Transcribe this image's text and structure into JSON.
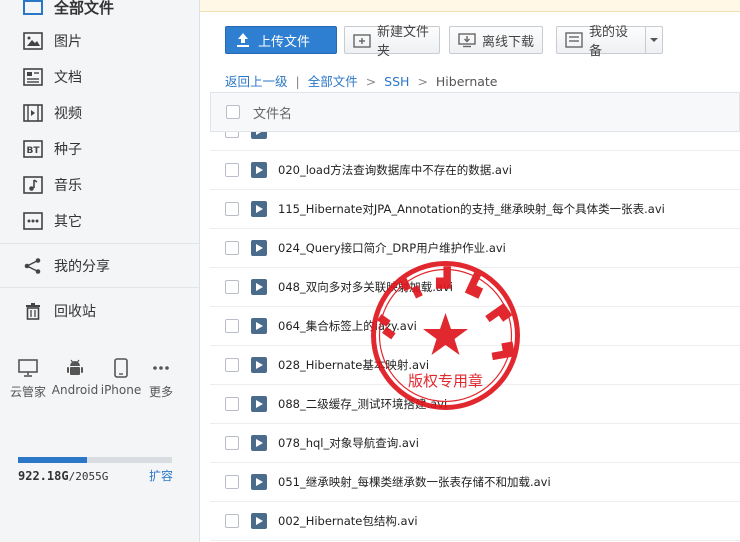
{
  "sidebar": {
    "top_item": "全部文件",
    "items": [
      {
        "label": "图片",
        "icon": "image-icon"
      },
      {
        "label": "文档",
        "icon": "document-icon"
      },
      {
        "label": "视频",
        "icon": "video-icon"
      },
      {
        "label": "种子",
        "icon": "bt-icon"
      },
      {
        "label": "音乐",
        "icon": "music-icon"
      },
      {
        "label": "其它",
        "icon": "other-icon"
      }
    ],
    "share": "我的分享",
    "recycle": "回收站",
    "devices": [
      {
        "label": "云管家",
        "icon": "monitor-icon"
      },
      {
        "label": "Android",
        "icon": "android-icon"
      },
      {
        "label": "iPhone",
        "icon": "phone-icon"
      },
      {
        "label": "更多",
        "icon": "more-icon"
      }
    ],
    "storage": {
      "used": "922.18G",
      "total": "2055G",
      "separator": "/",
      "fraction": 0.449
    },
    "expand": "扩容"
  },
  "toolbar": {
    "upload": "上传文件",
    "new_folder": "新建文件夹",
    "offline": "离线下载",
    "devices": "我的设备"
  },
  "breadcrumb": {
    "back": "返回上一级",
    "divider": "|",
    "items": [
      "全部文件",
      "SSH",
      "Hibernate"
    ],
    "arrow": ">"
  },
  "list": {
    "header": "文件名",
    "files": [
      "020_load方法查询数据库中不存在的数据.avi",
      "115_Hibernate对JPA_Annotation的支持_继承映射_每个具体类一张表.avi",
      "024_Query接口简介_DRP用户维护作业.avi",
      "048_双向多对多关联映射加载.avi",
      "064_集合标签上的lazy.avi",
      "028_Hibernate基本映射.avi",
      "088_二级缓存_测试环境搭建.avi",
      "078_hql_对象导航查询.avi",
      "051_继承映射_每棵类继承数一张表存储不和加载.avi",
      "002_Hibernate包结构.avi"
    ]
  },
  "stamp": {
    "bottom_text": "版权专用章",
    "color": "#e0161e"
  }
}
